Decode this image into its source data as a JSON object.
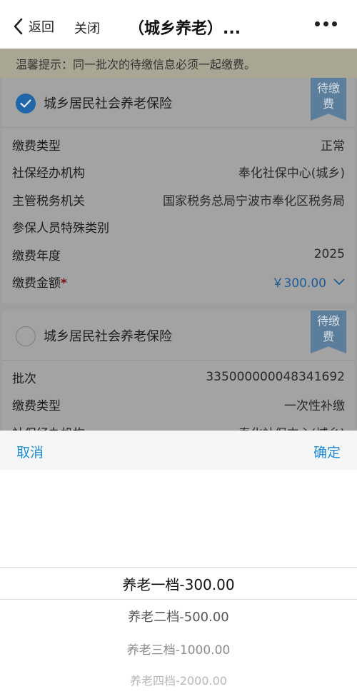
{
  "header": {
    "back_label": "返回",
    "close_label": "关闭",
    "title": "（城乡养老）..."
  },
  "notice": "温馨提示：同一批次的待缴信息必须一起缴费。",
  "cards": [
    {
      "title": "城乡居民社会养老保险",
      "badge": "待缴\n费",
      "badge_line1": "待缴",
      "badge_line2": "费",
      "checked": true,
      "rows": [
        {
          "label": "缴费类型",
          "value": "正常"
        },
        {
          "label": "社保经办机构",
          "value": "奉化社保中心(城乡)"
        },
        {
          "label": "主管税务机关",
          "value": "国家税务总局宁波市奉化区税务局"
        },
        {
          "label": "参保人员特殊类别",
          "value": ""
        },
        {
          "label": "缴费年度",
          "value": "2025"
        }
      ],
      "amount_label": "缴费金额",
      "amount_value": "￥300.00"
    },
    {
      "title": "城乡居民社会养老保险",
      "badge_line1": "待缴",
      "badge_line2": "费",
      "checked": false,
      "rows": [
        {
          "label": "批次",
          "value": "335000000048341692"
        },
        {
          "label": "缴费类型",
          "value": "一次性补缴"
        },
        {
          "label": "社保经办机构",
          "value": "奉化社保中心(城乡)"
        }
      ]
    }
  ],
  "picker": {
    "cancel_label": "取消",
    "confirm_label": "确定",
    "options": [
      "养老一档-300.00",
      "养老二档-500.00",
      "养老三档-1000.00",
      "养老四档-2000.00"
    ],
    "selected": "养老一档-300.00"
  },
  "colors": {
    "accent": "#1e8ed7",
    "checked": "#1f67a8",
    "badge": "#5a7e9b"
  }
}
